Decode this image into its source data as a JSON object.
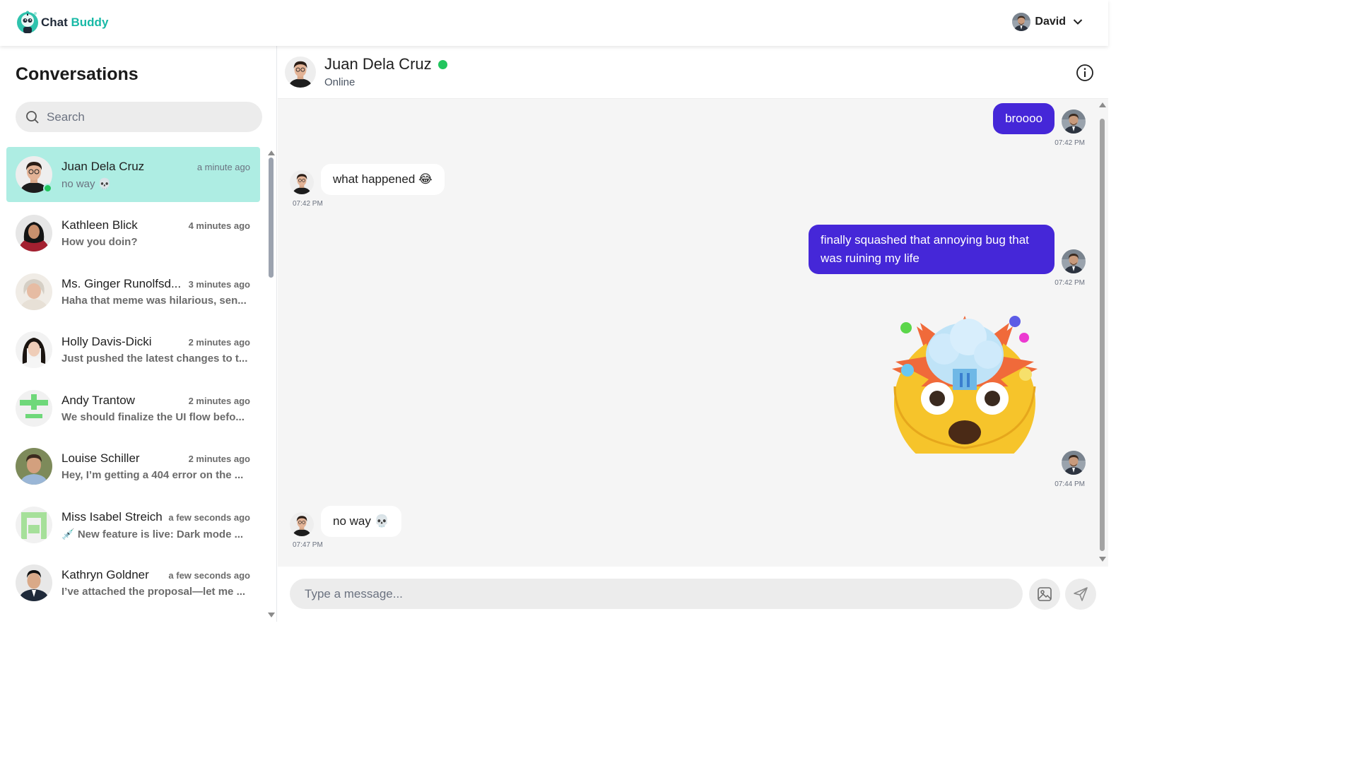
{
  "app": {
    "name_part1": "Chat",
    "name_part2": "Buddy",
    "accent": "#18b9a6",
    "icon": "robot-logo-icon"
  },
  "user": {
    "name": "David",
    "menu_icon": "chevron-down-icon"
  },
  "sidebar": {
    "title": "Conversations",
    "search_placeholder": "Search",
    "conversations": [
      {
        "name": "Juan Dela Cruz",
        "time": "a minute ago",
        "preview": "no way 💀",
        "active": true,
        "online": true
      },
      {
        "name": "Kathleen Blick",
        "time": "4 minutes ago",
        "preview": "How you doin?"
      },
      {
        "name": "Ms. Ginger Runolfsd...",
        "time": "3 minutes ago",
        "preview": "Haha that meme was hilarious, sen..."
      },
      {
        "name": "Holly Davis-Dicki",
        "time": "2 minutes ago",
        "preview": "Just pushed the latest changes to t..."
      },
      {
        "name": "Andy Trantow",
        "time": "2 minutes ago",
        "preview": "We should finalize the UI flow befo..."
      },
      {
        "name": "Louise Schiller",
        "time": "2 minutes ago",
        "preview": "Hey, I’m getting a 404 error on the ..."
      },
      {
        "name": "Miss Isabel Streich",
        "time": "a few seconds ago",
        "preview": "💉 New feature is live: Dark mode ..."
      },
      {
        "name": "Kathryn Goldner",
        "time": "a few seconds ago",
        "preview": "I’ve attached the proposal—let me ..."
      }
    ]
  },
  "chat": {
    "contact_name": "Juan Dela Cruz",
    "status": "Online",
    "messages": [
      {
        "direction": "out",
        "text": "broooo",
        "time": "07:42 PM"
      },
      {
        "direction": "in",
        "text": "what happened 😂",
        "time": "07:42 PM"
      },
      {
        "direction": "out",
        "text": "finally squashed that annoying bug that was ruining my life",
        "time": "07:42 PM"
      },
      {
        "direction": "out",
        "sticker": "exploding-head-emoji",
        "time": "07:44 PM"
      },
      {
        "direction": "in",
        "text": "no way 💀",
        "time": "07:47 PM"
      }
    ]
  },
  "composer": {
    "placeholder": "Type a message..."
  },
  "colors": {
    "outgoing_bubble": "#4527d8",
    "active_conversation": "#aeede3",
    "online": "#22c55e"
  }
}
